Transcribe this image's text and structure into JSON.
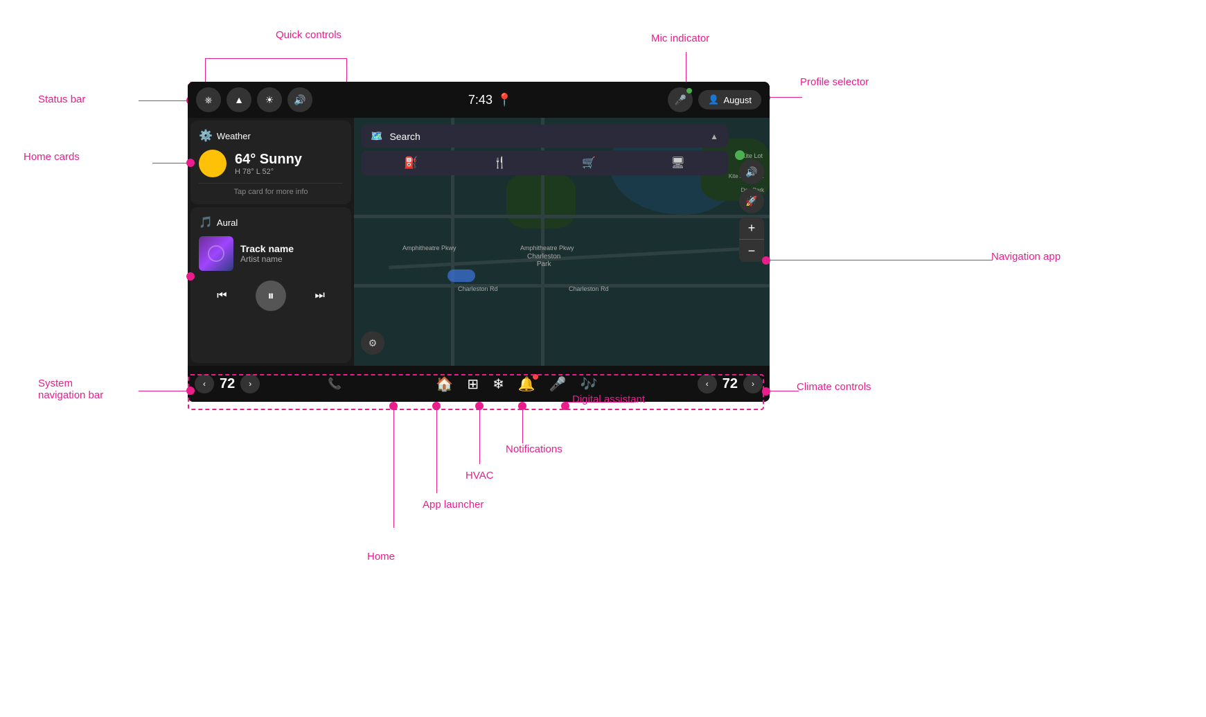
{
  "annotations": {
    "quick_controls": "Quick controls",
    "status_bar": "Status bar",
    "home_cards": "Home cards",
    "mic_indicator": "Mic indicator",
    "profile_selector": "Profile selector",
    "navigation_app": "Navigation app",
    "system_navigation_bar": "System\nnavigation bar",
    "climate_controls": "Climate controls",
    "digital_assistant": "Digital assistant",
    "notifications": "Notifications",
    "hvac": "HVAC",
    "app_launcher": "App launcher",
    "home": "Home"
  },
  "status_bar": {
    "time": "7:43",
    "profile_name": "August"
  },
  "weather_card": {
    "title": "Weather",
    "temperature": "64° Sunny",
    "range": "H 78° L 52°",
    "tap_info": "Tap card for more info"
  },
  "music_card": {
    "app_name": "Aural",
    "track_name": "Track name",
    "artist_name": "Artist name"
  },
  "search": {
    "placeholder": "Search"
  },
  "system_nav": {
    "temp_left": "72",
    "temp_right": "72"
  }
}
